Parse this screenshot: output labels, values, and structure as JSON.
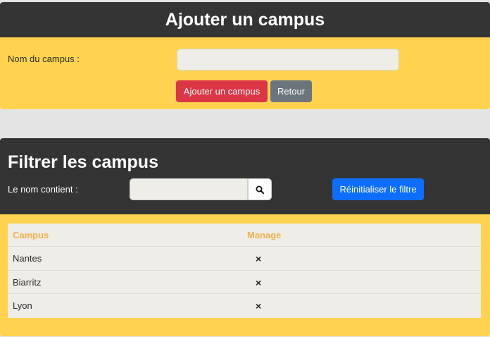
{
  "add_card": {
    "title": "Ajouter un campus",
    "name_label": "Nom du campus :",
    "name_value": "",
    "add_button": "Ajouter un campus",
    "back_button": "Retour"
  },
  "filter_card": {
    "title": "Filtrer les campus",
    "filter_label": "Le nom contient :",
    "filter_value": "",
    "search_icon": "search-icon",
    "reset_button": "Réinitialiser le filtre"
  },
  "table": {
    "headers": [
      "Campus",
      "Manage"
    ],
    "rows": [
      {
        "name": "Nantes",
        "action": "×"
      },
      {
        "name": "Biarritz",
        "action": "×"
      },
      {
        "name": "Lyon",
        "action": "×"
      }
    ]
  },
  "colors": {
    "header_bg": "#343434",
    "card_bg": "#ffd34f",
    "danger": "#dc3545",
    "secondary": "#6c757d",
    "primary": "#0d6efd",
    "table_header_text": "#f0b24b"
  }
}
